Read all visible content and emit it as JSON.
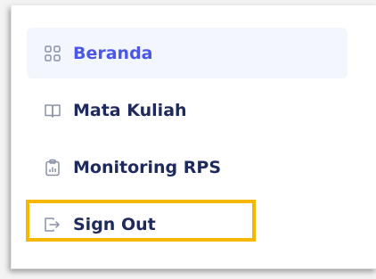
{
  "sidebar": {
    "items": [
      {
        "label": "Beranda",
        "icon": "grid-icon",
        "active": true
      },
      {
        "label": "Mata Kuliah",
        "icon": "book-open-icon",
        "active": false
      },
      {
        "label": "Monitoring RPS",
        "icon": "clipboard-chart-icon",
        "active": false
      },
      {
        "label": "Sign Out",
        "icon": "sign-out-icon",
        "active": false
      }
    ]
  },
  "colors": {
    "active_text": "#4a57e8",
    "active_bg": "#f3f6fd",
    "text": "#1f2a5c",
    "icon": "#8a92a6",
    "highlight": "#f5b800"
  }
}
